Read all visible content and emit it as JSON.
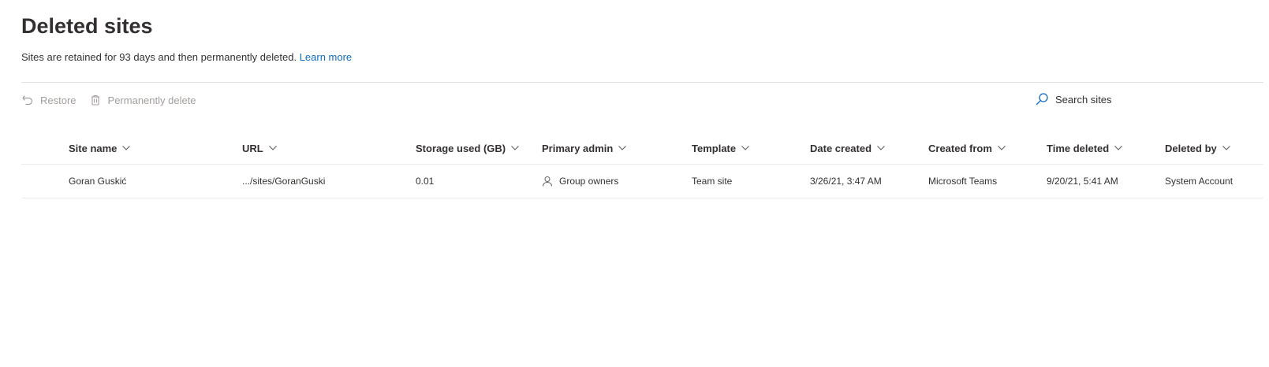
{
  "page": {
    "title": "Deleted sites",
    "description": "Sites are retained for 93 days and then permanently deleted.",
    "learn_more": "Learn more"
  },
  "toolbar": {
    "restore_label": "Restore",
    "restore_icon": "undo-icon",
    "delete_label": "Permanently delete",
    "delete_icon": "trash-icon"
  },
  "search": {
    "placeholder": "Search sites",
    "icon": "search-icon"
  },
  "table": {
    "columns": [
      "Site name",
      "URL",
      "Storage used (GB)",
      "Primary admin",
      "Template",
      "Date created",
      "Created from",
      "Time deleted",
      "Deleted by"
    ],
    "rows": [
      {
        "site_name": "Goran Guskić",
        "url": ".../sites/GoranGuski",
        "storage": "0.01",
        "primary_admin": "Group owners",
        "template": "Team site",
        "date_created": "3/26/21, 3:47 AM",
        "created_from": "Microsoft Teams",
        "time_deleted": "9/20/21, 5:41 AM",
        "deleted_by": "System Account"
      }
    ]
  },
  "colors": {
    "link": "#0f6cbd",
    "text": "#323130",
    "disabled": "#a19f9d",
    "divider": "#e1dfdd"
  }
}
